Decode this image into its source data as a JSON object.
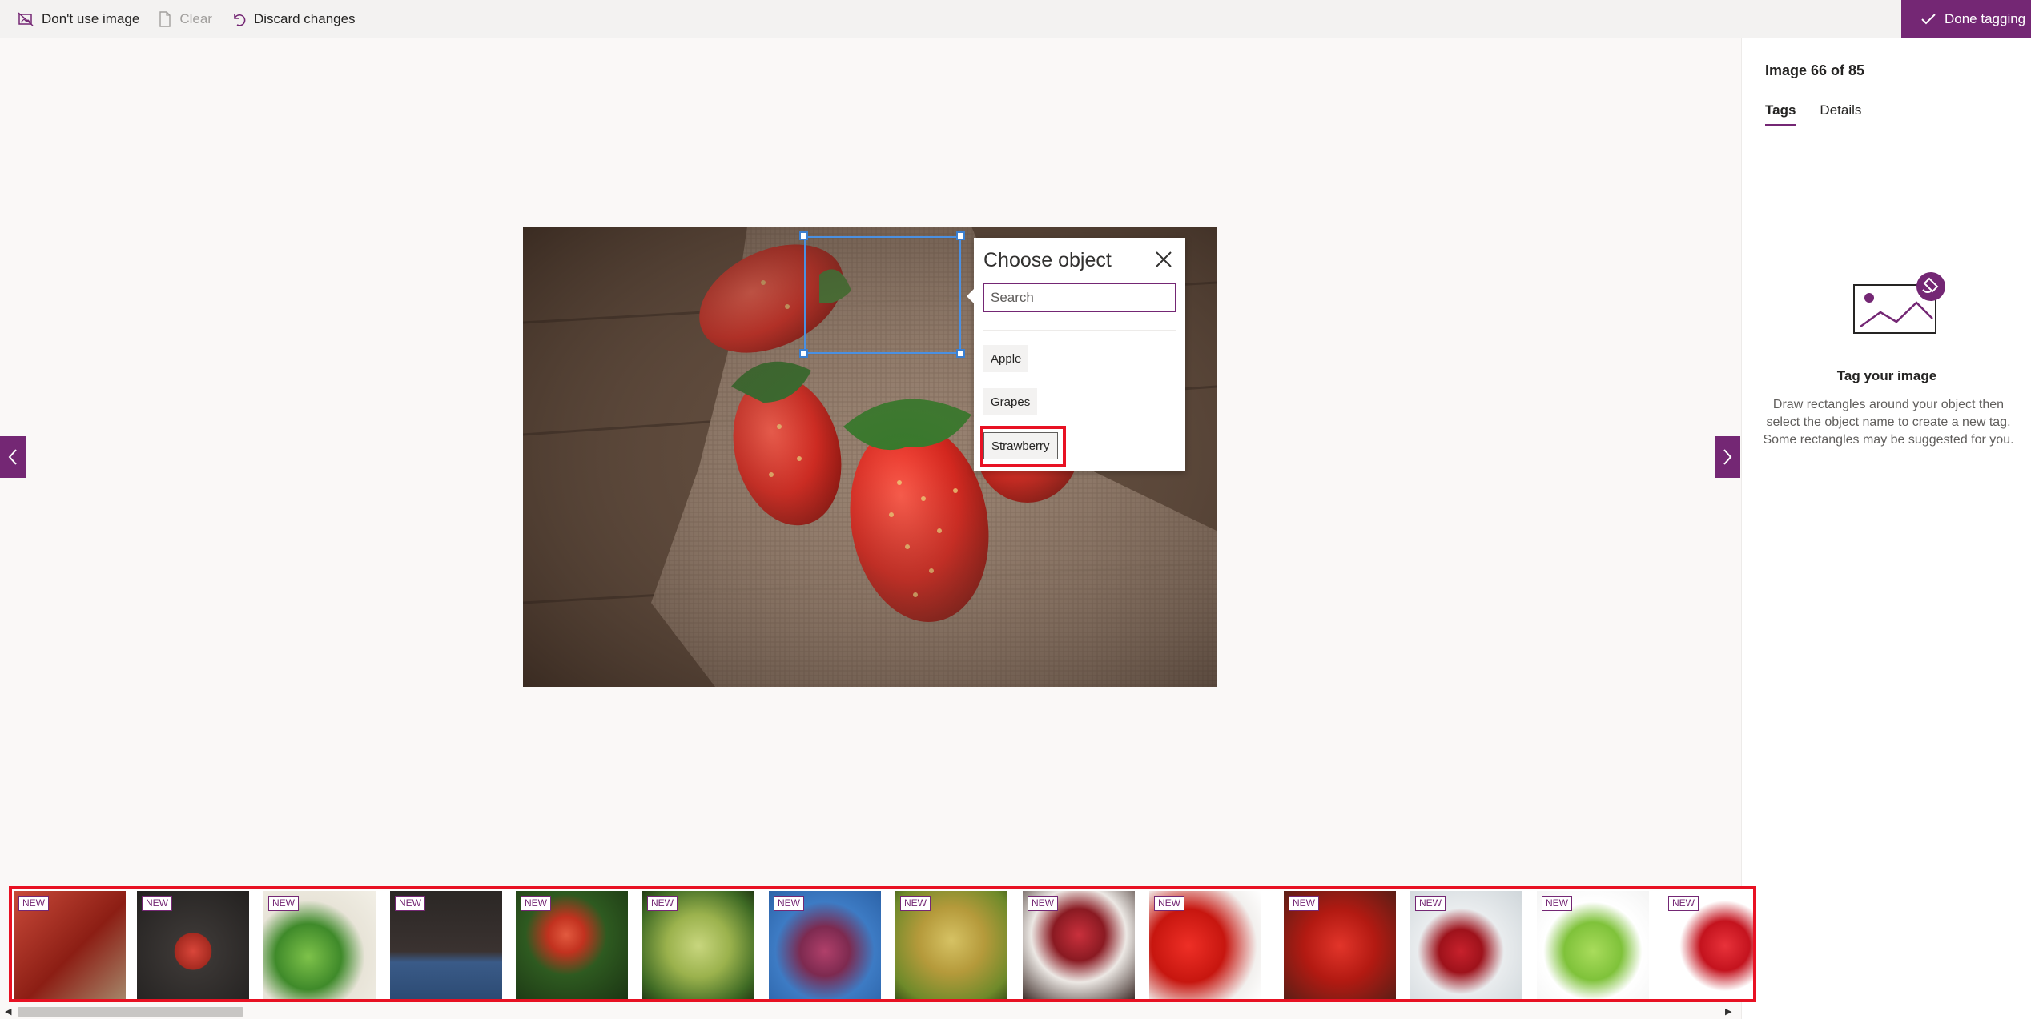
{
  "toolbar": {
    "dont_use_label": "Don't use image",
    "clear_label": "Clear",
    "discard_label": "Discard changes",
    "done_label": "Done tagging"
  },
  "panel": {
    "counter": "Image 66 of 85",
    "tabs": [
      "Tags",
      "Details"
    ],
    "active_tab": "Tags",
    "empty_title": "Tag your image",
    "empty_desc": "Draw rectangles around your object then select the object name to create a new tag. Some rectangles may be suggested for you."
  },
  "popup": {
    "title": "Choose object",
    "search_placeholder": "Search",
    "options": [
      "Apple",
      "Grapes",
      "Strawberry"
    ],
    "highlighted_option": "Strawberry"
  },
  "filmstrip": {
    "badge": "NEW",
    "thumbnails": [
      {
        "subject": "apples on wood"
      },
      {
        "subject": "red apple dark"
      },
      {
        "subject": "green fruits and juice"
      },
      {
        "subject": "apples on blue cloth"
      },
      {
        "subject": "apple on tree"
      },
      {
        "subject": "green grapes on vine"
      },
      {
        "subject": "red grapes blue sky"
      },
      {
        "subject": "yellow grapes"
      },
      {
        "subject": "strawberries in bowl"
      },
      {
        "subject": "red strawberries"
      },
      {
        "subject": "strawberries close-up"
      },
      {
        "subject": "strawberry splash"
      },
      {
        "subject": "green apples"
      },
      {
        "subject": "red apple white"
      }
    ]
  },
  "colors": {
    "accent": "#742774",
    "highlight": "#e81123",
    "selection": "#4a90e2"
  }
}
